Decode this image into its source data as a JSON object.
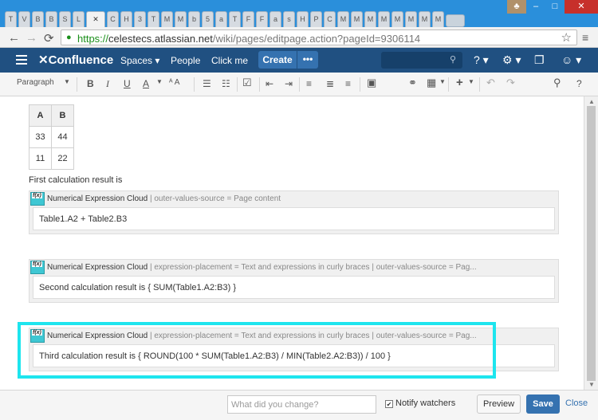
{
  "browser": {
    "tabs": [
      "T",
      "V",
      "B",
      "B",
      "S",
      "L",
      "",
      "C",
      "H",
      "3",
      "T",
      "M",
      "M",
      "b",
      "5",
      "a",
      "T",
      "F",
      "F",
      "a",
      "s",
      "H",
      "P",
      "C",
      "M",
      "M",
      "M",
      "M",
      "M",
      "M",
      "M",
      "M"
    ],
    "url_https": "https://",
    "url_host": "celestecs.atlassian.net",
    "url_path": "/wiki/pages/editpage.action?pageId=9306114",
    "back_icon": "←",
    "forward_icon": "→",
    "reload_icon": "⟳",
    "star_icon": "☆",
    "menu_icon": "≡",
    "min_icon": "–",
    "max_icon": "□",
    "close_icon": "✕",
    "user_icon": "♣"
  },
  "header": {
    "logo": "✕Confluence",
    "spaces": "Spaces ▾",
    "people": "People",
    "clickme": "Click me",
    "create": "Create",
    "more": "•••",
    "search_icon": "⚲",
    "help_icon": "? ▾",
    "settings_icon": "⚙ ▾",
    "notif_icon": "❐",
    "user_icon": "☺ ▾"
  },
  "toolbar": {
    "paragraph": "Paragraph",
    "bold": "B",
    "italic": "I",
    "underline": "U",
    "textcolor": "A",
    "format": "ᴬ A",
    "bullet": "☰",
    "numbered": "☷",
    "task": "☑",
    "outdent": "⇤",
    "indent": "⇥",
    "align_left": "≡",
    "align_center": "≣",
    "align_right": "≡",
    "layout": "▣",
    "link": "⚭",
    "table": "▦",
    "insert": "+",
    "undo": "↶",
    "redo": "↷",
    "find": "⚲",
    "help": "?"
  },
  "table": {
    "headers": [
      "A",
      "B"
    ],
    "rows": [
      [
        "33",
        "44"
      ],
      [
        "11",
        "22"
      ]
    ]
  },
  "content": {
    "first_label": "First calculation result is",
    "macro_name": "Numerical Expression Cloud",
    "macro1_params": " | outer-values-source = Page content",
    "macro1_body": "Table1.A2 + Table2.B3",
    "macro2_params": " | expression-placement = Text and expressions in curly braces | outer-values-source = Pag...",
    "macro2_body": "Second calculation result is { SUM(Table1.A2:B3) }",
    "macro3_params": " | expression-placement = Text and expressions in curly braces | outer-values-source = Pag...",
    "macro3_body": "Third calculation result is { ROUND(100 * SUM(Table1.A2:B3) / MIN(Table2.A2:B3)) / 100 }"
  },
  "footer": {
    "change_placeholder": "What did you change?",
    "notify_label": "Notify watchers",
    "notify_checked": "✔",
    "preview": "Preview",
    "save": "Save",
    "close": "Close"
  }
}
